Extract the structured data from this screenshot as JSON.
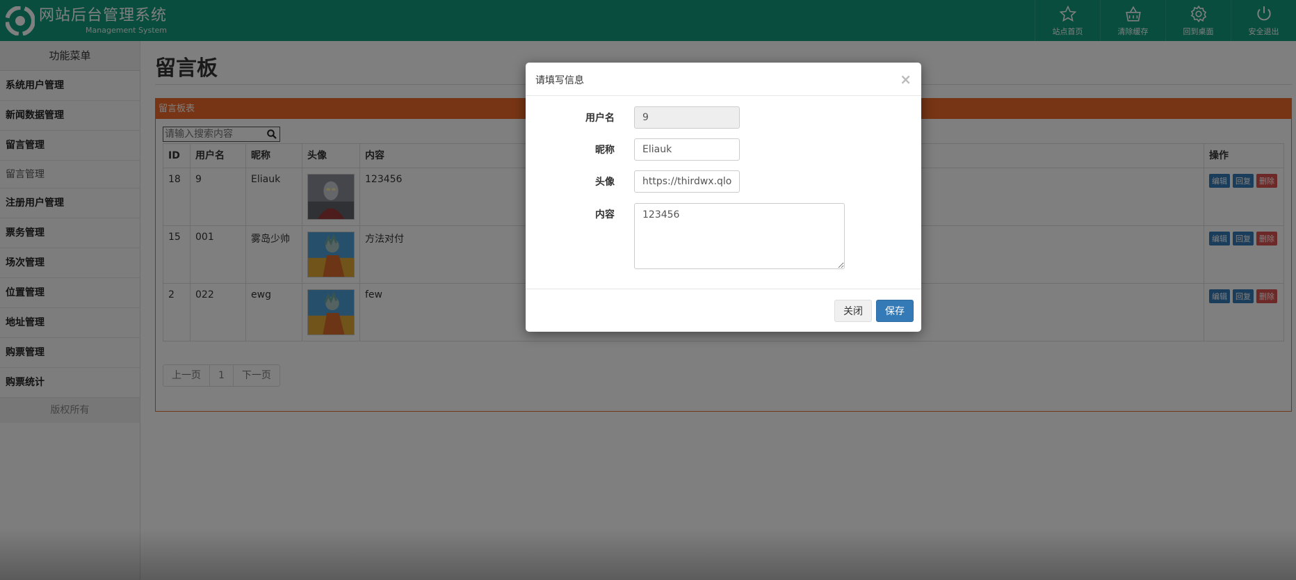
{
  "header": {
    "title": "网站后台管理系统",
    "subtitle": "Management System",
    "nav": [
      {
        "label": "站点首页",
        "icon": "star-icon"
      },
      {
        "label": "清除缓存",
        "icon": "basket-icon"
      },
      {
        "label": "回到桌面",
        "icon": "gear-icon"
      },
      {
        "label": "安全退出",
        "icon": "power-icon"
      }
    ]
  },
  "sidebar": {
    "heading": "功能菜单",
    "items": [
      "系统用户管理",
      "新闻数据管理",
      "留言管理",
      "留言管理",
      "注册用户管理",
      "票务管理",
      "场次管理",
      "位置管理",
      "地址管理",
      "购票管理",
      "购票统计"
    ],
    "footer": "版权所有"
  },
  "main": {
    "title": "留言板",
    "panel_title": "留言板表",
    "search_placeholder": "请输入搜索内容",
    "columns": [
      "ID",
      "用户名",
      "昵称",
      "头像",
      "内容",
      "操作"
    ],
    "rows": [
      {
        "id": "18",
        "username": "9",
        "nickname": "Eliauk",
        "content": "123456"
      },
      {
        "id": "15",
        "username": "001",
        "nickname": "雾岛少帅",
        "content": "方法对付"
      },
      {
        "id": "2",
        "username": "022",
        "nickname": "ewg",
        "content": "few"
      }
    ],
    "row_actions": {
      "edit": "编辑",
      "reply": "回复",
      "delete": "删除"
    },
    "pager": {
      "prev": "上一页",
      "page": "1",
      "next": "下一页"
    }
  },
  "modal": {
    "title": "请填写信息",
    "close_symbol": "×",
    "fields": {
      "username": {
        "label": "用户名",
        "value": "9"
      },
      "nickname": {
        "label": "昵称",
        "value": "Eliauk"
      },
      "avatar": {
        "label": "头像",
        "value": "https://thirdwx.qlogo.c"
      },
      "content": {
        "label": "内容",
        "value": "123456"
      }
    },
    "close_label": "关闭",
    "save_label": "保存"
  },
  "colors": {
    "header": "#109b7d",
    "panel": "#ee6b2a",
    "primary": "#337ab7",
    "danger": "#d9534f"
  }
}
